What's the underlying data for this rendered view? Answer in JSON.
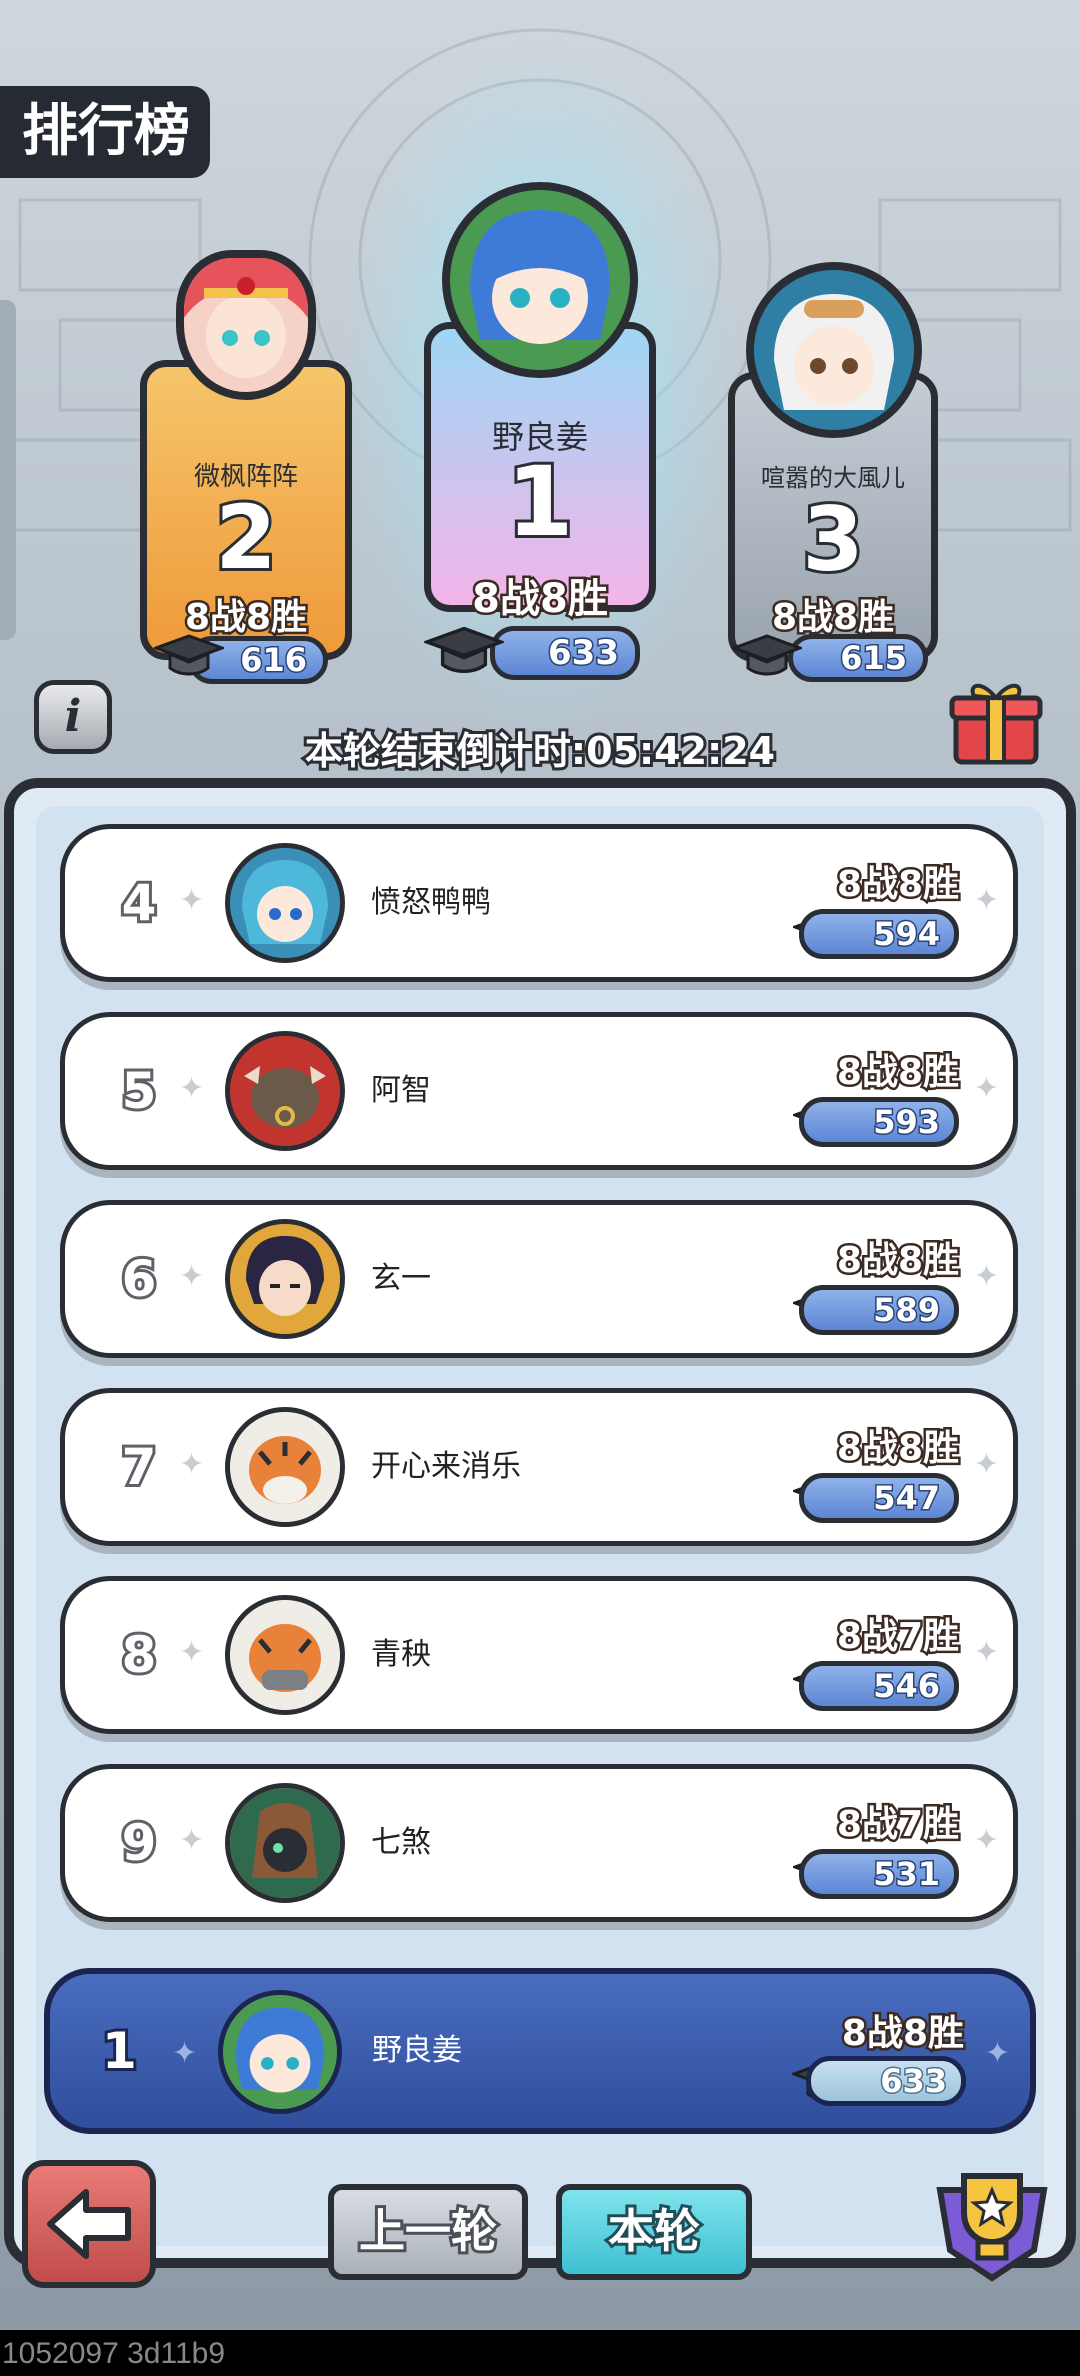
{
  "header": {
    "title": "排行榜"
  },
  "podium": [
    {
      "rank": "2",
      "name": "微枫阵阵",
      "wins": "8战8胜",
      "score": "616"
    },
    {
      "rank": "1",
      "name": "野良姜",
      "wins": "8战8胜",
      "score": "633"
    },
    {
      "rank": "3",
      "name": "喧嚣的大風儿",
      "wins": "8战8胜",
      "score": "615"
    }
  ],
  "timer": "本轮结束倒计时:05:42:24",
  "list": [
    {
      "rank": "4",
      "name": "愤怒鸭鸭",
      "wins": "8战8胜",
      "score": "594"
    },
    {
      "rank": "5",
      "name": "阿智",
      "wins": "8战8胜",
      "score": "593"
    },
    {
      "rank": "6",
      "name": "玄一",
      "wins": "8战8胜",
      "score": "589"
    },
    {
      "rank": "7",
      "name": "开心来消乐",
      "wins": "8战8胜",
      "score": "547"
    },
    {
      "rank": "8",
      "name": "青秧",
      "wins": "8战7胜",
      "score": "546"
    },
    {
      "rank": "9",
      "name": "七煞",
      "wins": "8战7胜",
      "score": "531"
    }
  ],
  "me": {
    "rank": "1",
    "name": "野良姜",
    "wins": "8战8胜",
    "score": "633"
  },
  "tabs": {
    "prev": "上一轮",
    "current": "本轮"
  },
  "icons": {
    "info": "info-icon",
    "gift": "gift-icon",
    "back": "back-arrow-icon",
    "trophy": "trophy-icon",
    "cap": "graduation-cap-icon"
  },
  "colors": {
    "first_banner": "#d9b2ee",
    "second_banner": "#f0b24a",
    "third_banner": "#b9c2cc",
    "score_pill": "#6f95dd",
    "me_row": "#3b5cad",
    "current_tab": "#55cbdc"
  },
  "footer": "1052097 3d11b9"
}
